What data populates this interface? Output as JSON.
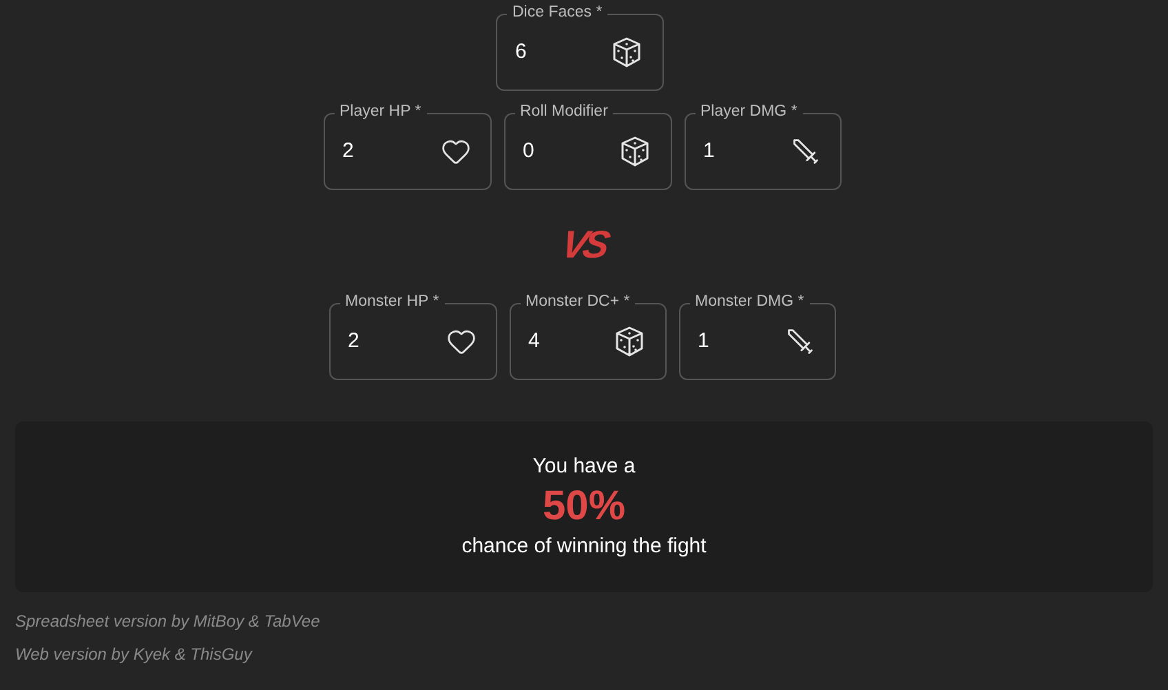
{
  "rows": [
    [
      {
        "label": "Dice Faces *",
        "value": "6",
        "kind": "dice"
      }
    ],
    [
      {
        "label": "Player HP *",
        "value": "2",
        "kind": "heart"
      },
      {
        "label": "Roll Modifier",
        "value": "0",
        "kind": "dice"
      },
      {
        "label": "Player DMG *",
        "value": "1",
        "kind": "sword"
      }
    ],
    [
      {
        "label": "Monster HP *",
        "value": "2",
        "kind": "heart"
      },
      {
        "label": "Monster DC+ *",
        "value": "4",
        "kind": "dice"
      },
      {
        "label": "Monster DMG *",
        "value": "1",
        "kind": "sword"
      }
    ]
  ],
  "vs_logo": "VS",
  "result": {
    "intro": "You have a",
    "percent": "50%",
    "outro": "chance of winning the fight"
  },
  "credits": [
    "Spreadsheet version by MitBoy & TabVee",
    "Web version by Kyek & ThisGuy"
  ]
}
